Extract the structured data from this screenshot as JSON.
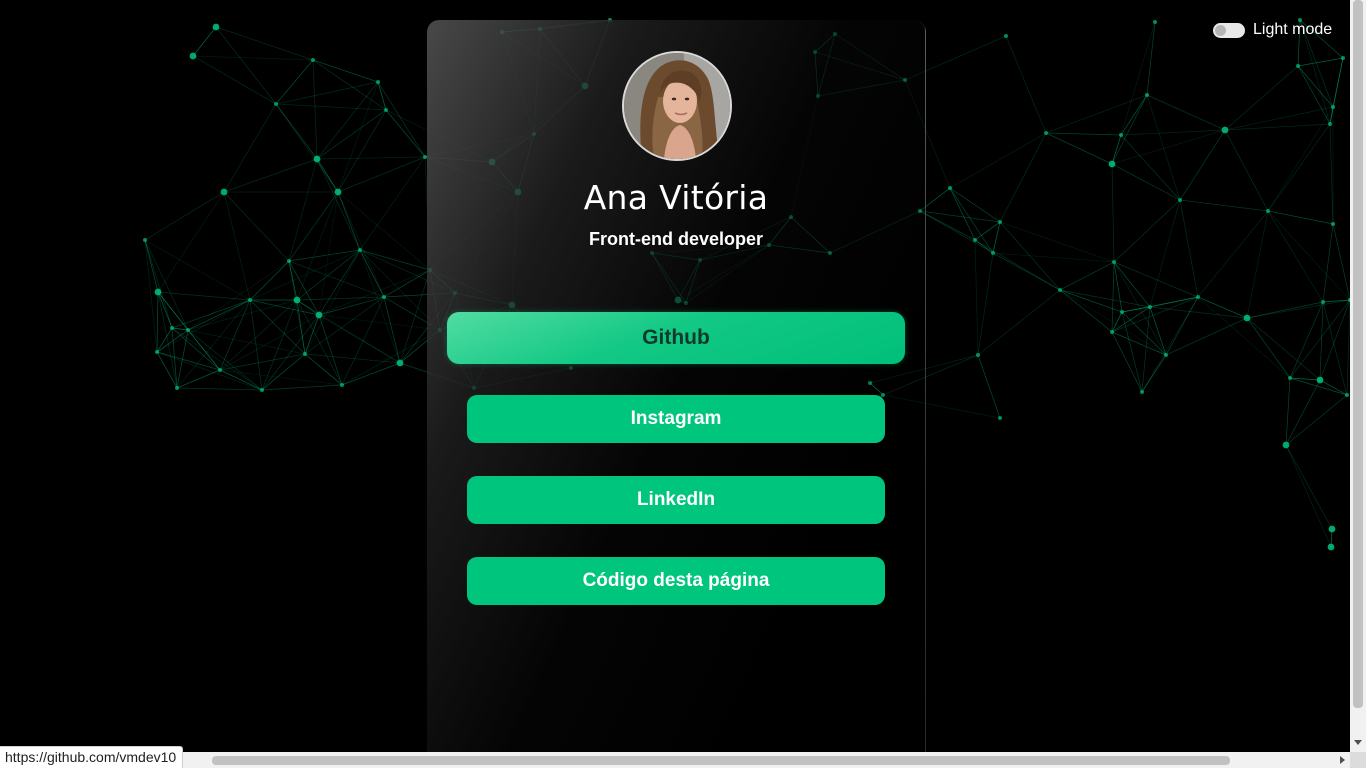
{
  "profile": {
    "name": "Ana Vitória",
    "role": "Front-end developer",
    "avatar_alt": "Ana Vitória"
  },
  "links": [
    {
      "label": "Github",
      "state": "hover"
    },
    {
      "label": "Instagram"
    },
    {
      "label": "LinkedIn"
    },
    {
      "label": "Código desta página"
    }
  ],
  "theme_toggle": {
    "label": "Light mode",
    "checked": false
  },
  "status_bar": {
    "url": "https://github.com/vmdev10"
  },
  "colors": {
    "background": "#000000",
    "accent": "#00c57d",
    "network": "#00c57d"
  },
  "icons": {
    "scroll_down": "triangle-down",
    "scroll_right": "triangle-right"
  }
}
